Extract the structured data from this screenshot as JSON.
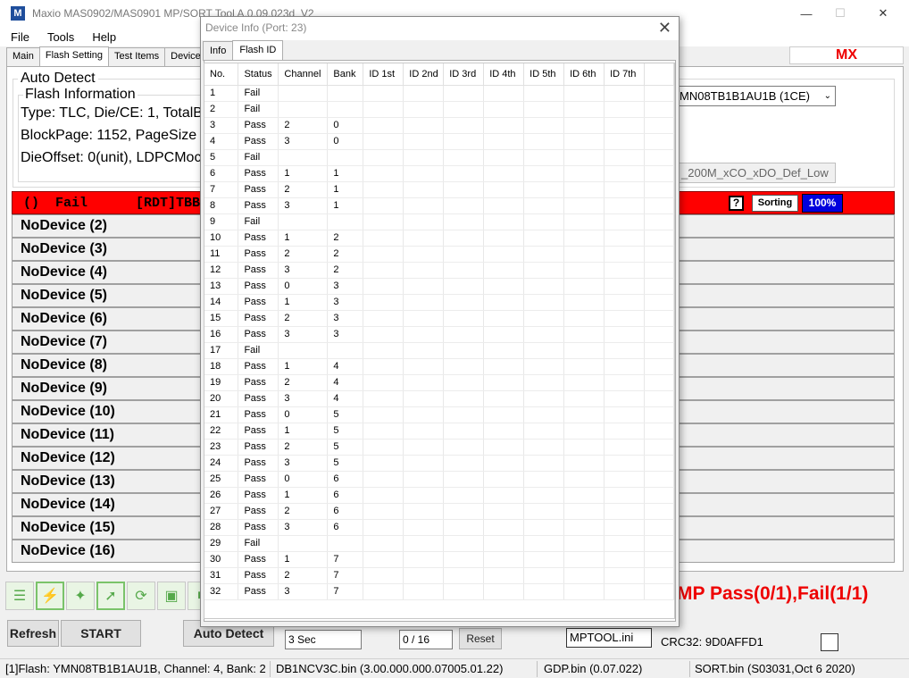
{
  "window": {
    "title": "Maxio MAS0902/MAS0901 MP/SORT Tool A.0.09.023d_V2",
    "app_icon": "M",
    "minimize_glyph": "—",
    "maximize_glyph": "☐",
    "close_glyph": "✕"
  },
  "menu": [
    "File",
    "Tools",
    "Help"
  ],
  "main_tabs": [
    "Main",
    "Flash Setting",
    "Test Items",
    "Device"
  ],
  "mx_label": "MX",
  "auto_detect": {
    "group_label": "Auto Detect",
    "flash_info_label": "Flash Information",
    "line1": "Type: TLC, Die/CE: 1, TotalB",
    "line2": "BlockPage: 1152, PageSize",
    "line3": "DieOffset: 0(unit), LDPCMoc",
    "flash_select": "MN08TB1B1AU1B (1CE)",
    "setting_text": "_200M_xCO_xDO_Def_Low"
  },
  "port_status": {
    "text": "()  Fail      [RDT]TBB:",
    "help_label": "?",
    "sorting_label": "Sorting",
    "percent": "100%",
    "color": "#ff0000"
  },
  "devices": [
    "NoDevice (2)",
    "NoDevice (3)",
    "NoDevice (4)",
    "NoDevice (5)",
    "NoDevice (6)",
    "NoDevice (7)",
    "NoDevice (8)",
    "NoDevice (9)",
    "NoDevice (10)",
    "NoDevice (11)",
    "NoDevice (12)",
    "NoDevice (13)",
    "NoDevice (14)",
    "NoDevice (15)",
    "NoDevice (16)"
  ],
  "toolbar_icons": [
    "list-icon",
    "lightning-icon",
    "pin-icon",
    "cursor-icon",
    "refresh-cycle-icon",
    "lock-icon",
    "stop-icon"
  ],
  "result_text": "MP  Pass(0/1),Fail(1/1)",
  "buttons": {
    "refresh": "Refresh",
    "start": "START",
    "auto_detect": "Auto Detect",
    "reset": "Reset"
  },
  "fields": {
    "interval": "3 Sec",
    "counter": "0 / 16",
    "ini": "MPTOOL.ini"
  },
  "crc": "CRC32: 9D0AFFD1",
  "statusbar": {
    "flash": "[1]Flash: YMN08TB1B1AU1B, Channel: 4, Bank: 2",
    "db": "DB1NCV3C.bin (3.00.000.000.07005.01.22)",
    "gdp": "GDP.bin (0.07.022)",
    "sort": "SORT.bin (S03031,Oct  6 2020)"
  },
  "dialog": {
    "title": "Device Info (Port: 23)",
    "close_glyph": "✕",
    "tabs": [
      "Info",
      "Flash ID"
    ],
    "columns": [
      "No.",
      "Status",
      "Channel",
      "Bank",
      "ID 1st",
      "ID 2nd",
      "ID 3rd",
      "ID 4th",
      "ID 5th",
      "ID 6th",
      "ID 7th"
    ],
    "rows": [
      [
        "1",
        "Fail",
        "",
        ""
      ],
      [
        "2",
        "Fail",
        "",
        ""
      ],
      [
        "3",
        "Pass",
        "2",
        "0"
      ],
      [
        "4",
        "Pass",
        "3",
        "0"
      ],
      [
        "5",
        "Fail",
        "",
        ""
      ],
      [
        "6",
        "Pass",
        "1",
        "1"
      ],
      [
        "7",
        "Pass",
        "2",
        "1"
      ],
      [
        "8",
        "Pass",
        "3",
        "1"
      ],
      [
        "9",
        "Fail",
        "",
        ""
      ],
      [
        "10",
        "Pass",
        "1",
        "2"
      ],
      [
        "11",
        "Pass",
        "2",
        "2"
      ],
      [
        "12",
        "Pass",
        "3",
        "2"
      ],
      [
        "13",
        "Pass",
        "0",
        "3"
      ],
      [
        "14",
        "Pass",
        "1",
        "3"
      ],
      [
        "15",
        "Pass",
        "2",
        "3"
      ],
      [
        "16",
        "Pass",
        "3",
        "3"
      ],
      [
        "17",
        "Fail",
        "",
        ""
      ],
      [
        "18",
        "Pass",
        "1",
        "4"
      ],
      [
        "19",
        "Pass",
        "2",
        "4"
      ],
      [
        "20",
        "Pass",
        "3",
        "4"
      ],
      [
        "21",
        "Pass",
        "0",
        "5"
      ],
      [
        "22",
        "Pass",
        "1",
        "5"
      ],
      [
        "23",
        "Pass",
        "2",
        "5"
      ],
      [
        "24",
        "Pass",
        "3",
        "5"
      ],
      [
        "25",
        "Pass",
        "0",
        "6"
      ],
      [
        "26",
        "Pass",
        "1",
        "6"
      ],
      [
        "27",
        "Pass",
        "2",
        "6"
      ],
      [
        "28",
        "Pass",
        "3",
        "6"
      ],
      [
        "29",
        "Fail",
        "",
        ""
      ],
      [
        "30",
        "Pass",
        "1",
        "7"
      ],
      [
        "31",
        "Pass",
        "2",
        "7"
      ],
      [
        "32",
        "Pass",
        "3",
        "7"
      ]
    ]
  }
}
